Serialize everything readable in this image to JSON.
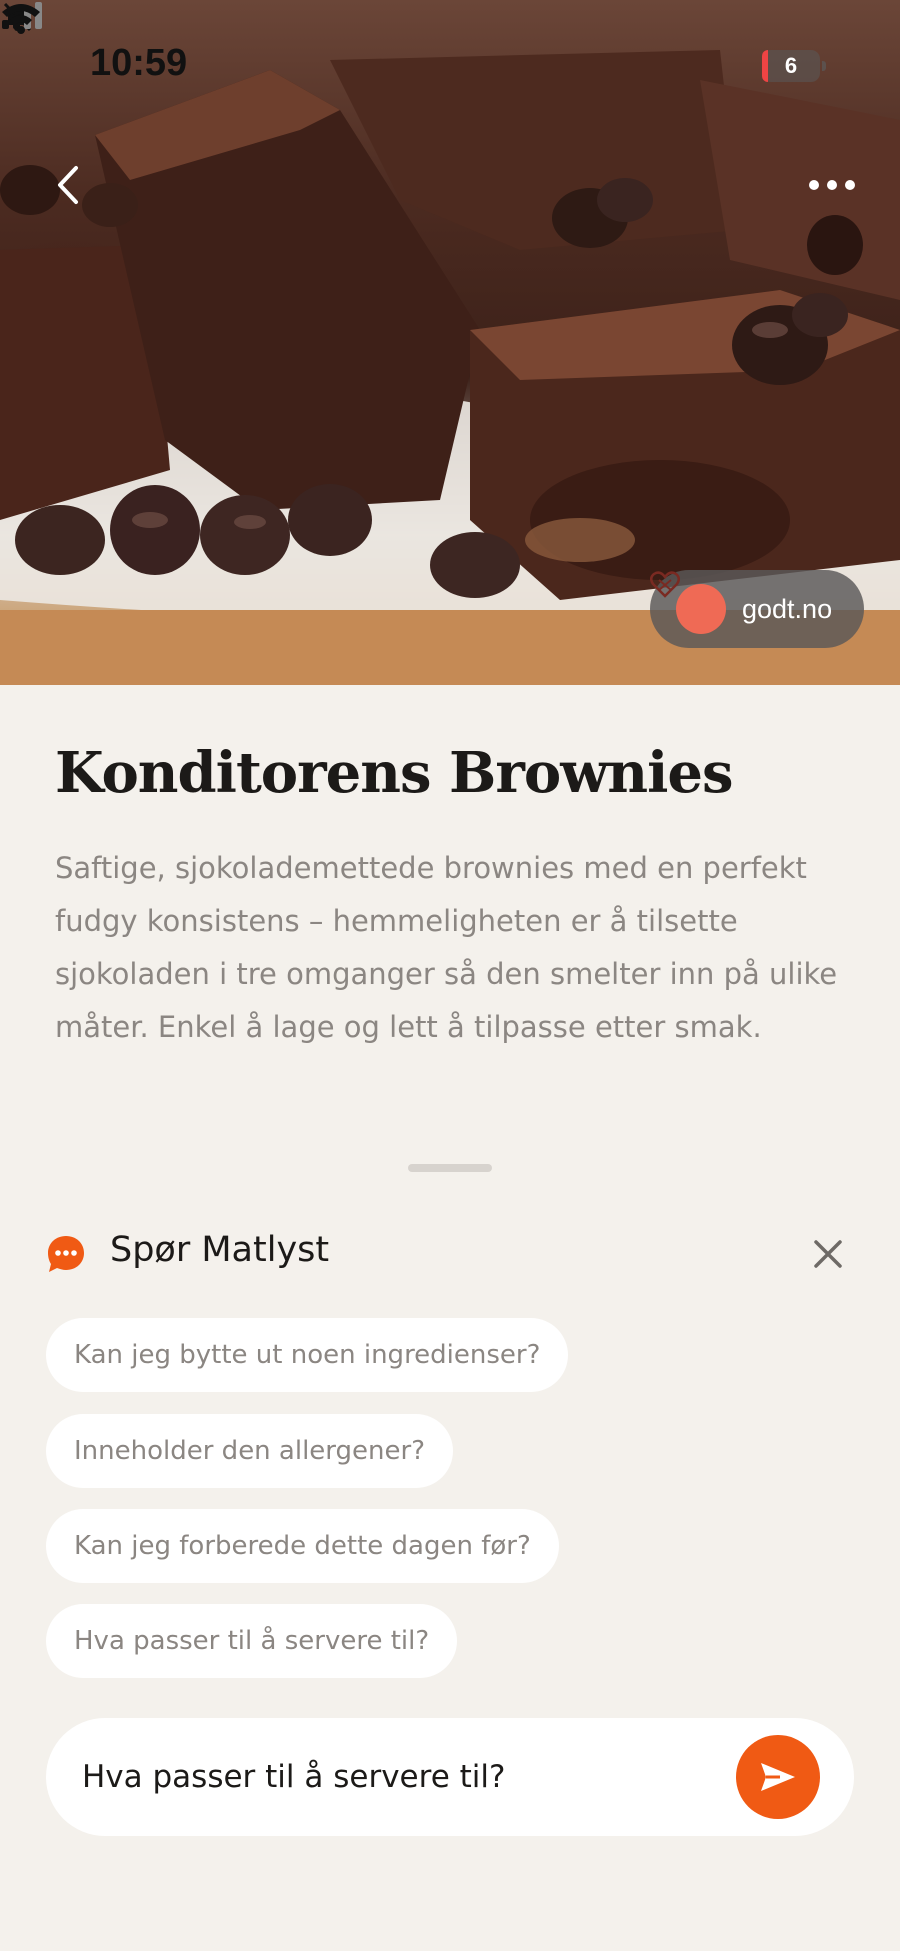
{
  "status_bar": {
    "time": "10:59",
    "battery": "6",
    "icons": [
      "bell-slash-icon",
      "signal-icon",
      "wifi-icon",
      "battery-icon"
    ]
  },
  "hero": {
    "image": "chocolate brownies photo",
    "back_icon": "chevron-left-icon",
    "more_icon": "ellipsis-icon",
    "source": {
      "label": "godt.no",
      "logo_icon": "heart-logo-icon"
    }
  },
  "recipe": {
    "title": "Konditorens Brownies",
    "description": "Saftige, sjokolademettede brownies med en perfekt fudgy konsistens – hemmeligheten er å tilsette sjokoladen i tre omganger så den smelter inn på ulike måter. Enkel å lage og lett å tilpasse etter smak."
  },
  "chat": {
    "title": "Spør Matlyst",
    "icon": "chat-bubble-icon",
    "close_icon": "close-icon",
    "suggestions": [
      "Kan jeg bytte ut noen ingredienser?",
      "Inneholder den allergener?",
      "Kan jeg forberede dette dagen før?",
      "Hva passer til å servere til?"
    ],
    "input_value": "Hva passer til å servere til?",
    "send_icon": "send-icon"
  },
  "colors": {
    "accent": "#f05a14",
    "background": "#f4f1ec",
    "chip_background": "#ffffff",
    "muted_text": "#8b8682",
    "title_text": "#1c1a18"
  }
}
